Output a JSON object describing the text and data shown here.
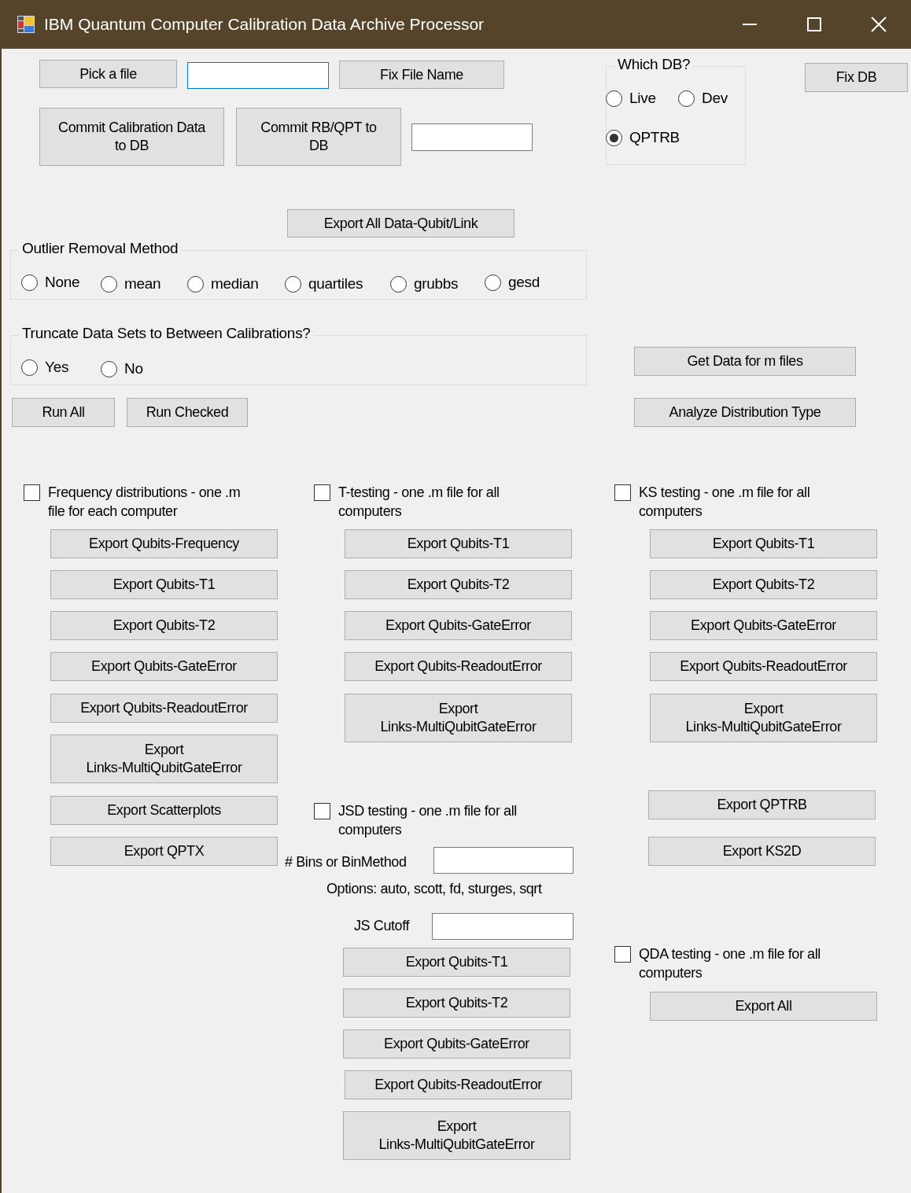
{
  "window": {
    "title": "IBM Quantum Computer Calibration Data Archive Processor"
  },
  "controls": [
    {
      "kind": "button",
      "label": "Pick a file"
    },
    {
      "kind": "field",
      "focused": true
    },
    {
      "kind": "button",
      "label": "Fix File Name"
    },
    {
      "kind": "group",
      "label": "Which DB?",
      "options": [
        {
          "label": "Live",
          "selected": false
        },
        {
          "label": "Dev",
          "selected": false
        },
        {
          "label": "QPTRB",
          "selected": true
        }
      ]
    },
    {
      "kind": "button",
      "label": "Fix DB"
    },
    {
      "kind": "button",
      "label": "Commit Calibration Data\nto DB"
    },
    {
      "kind": "button",
      "label": "Commit RB/QPT to\nDB"
    },
    {
      "kind": "field",
      "focused": false
    },
    {
      "kind": "button",
      "label": "Export All Data-Qubit/Link"
    },
    {
      "kind": "group",
      "label": "Outlier Removal Method",
      "options": [
        {
          "label": "None",
          "selected": false
        },
        {
          "label": "mean",
          "selected": false
        },
        {
          "label": "median",
          "selected": false
        },
        {
          "label": "quartiles",
          "selected": false
        },
        {
          "label": "grubbs",
          "selected": false
        },
        {
          "label": "gesd",
          "selected": false
        }
      ]
    },
    {
      "kind": "group",
      "label": "Truncate Data Sets to Between Calibrations?",
      "options": [
        {
          "label": "Yes",
          "selected": false
        },
        {
          "label": "No",
          "selected": false
        }
      ]
    },
    {
      "kind": "button",
      "label": "Get Data for m files"
    },
    {
      "kind": "button",
      "label": "Run All"
    },
    {
      "kind": "button",
      "label": "Run Checked"
    },
    {
      "kind": "button",
      "label": "Analyze Distribution Type"
    },
    {
      "kind": "checkbox",
      "label": "Frequency distributions - one .m\nfile for each computer",
      "checked": false
    },
    {
      "kind": "checkbox",
      "label": "T-testing - one .m file for all\ncomputers",
      "checked": false
    },
    {
      "kind": "checkbox",
      "label": "KS testing - one .m file for all\ncomputers",
      "checked": false
    },
    {
      "kind": "button",
      "label": "Export Qubits-Frequency"
    },
    {
      "kind": "button",
      "label": "Export Qubits-T1"
    },
    {
      "kind": "button",
      "label": "Export Qubits-T2"
    },
    {
      "kind": "button",
      "label": "Export Qubits-GateError"
    },
    {
      "kind": "button",
      "label": "Export Qubits-ReadoutError"
    },
    {
      "kind": "button",
      "label": "Export\nLinks-MultiQubitGateError"
    },
    {
      "kind": "button",
      "label": "Export Scatterplots"
    },
    {
      "kind": "button",
      "label": "Export QPTX"
    },
    {
      "kind": "button",
      "label": "Export Qubits-T1"
    },
    {
      "kind": "button",
      "label": "Export Qubits-T2"
    },
    {
      "kind": "button",
      "label": "Export Qubits-GateError"
    },
    {
      "kind": "button",
      "label": "Export Qubits-ReadoutError"
    },
    {
      "kind": "button",
      "label": "Export\nLinks-MultiQubitGateError"
    },
    {
      "kind": "button",
      "label": "Export Qubits-T1"
    },
    {
      "kind": "button",
      "label": "Export Qubits-T2"
    },
    {
      "kind": "button",
      "label": "Export Qubits-GateError"
    },
    {
      "kind": "button",
      "label": "Export Qubits-ReadoutError"
    },
    {
      "kind": "button",
      "label": "Export\nLinks-MultiQubitGateError"
    },
    {
      "kind": "checkbox",
      "label": "JSD testing - one .m file for all\ncomputers",
      "checked": false
    },
    {
      "kind": "label",
      "label": "# Bins or BinMethod"
    },
    {
      "kind": "field",
      "focused": false
    },
    {
      "kind": "label",
      "label": "Options: auto, scott, fd, sturges, sqrt"
    },
    {
      "kind": "label",
      "label": "JS Cutoff"
    },
    {
      "kind": "field",
      "focused": false
    },
    {
      "kind": "button",
      "label": "Export Qubits-T1"
    },
    {
      "kind": "button",
      "label": "Export Qubits-T2"
    },
    {
      "kind": "button",
      "label": "Export Qubits-GateError"
    },
    {
      "kind": "button",
      "label": "Export Qubits-ReadoutError"
    },
    {
      "kind": "button",
      "label": "Export\nLinks-MultiQubitGateError"
    },
    {
      "kind": "button",
      "label": "Export QPTRB"
    },
    {
      "kind": "button",
      "label": "Export KS2D"
    },
    {
      "kind": "checkbox",
      "label": "QDA testing - one .m file for all\ncomputers",
      "checked": false
    },
    {
      "kind": "button",
      "label": "Export All"
    }
  ]
}
